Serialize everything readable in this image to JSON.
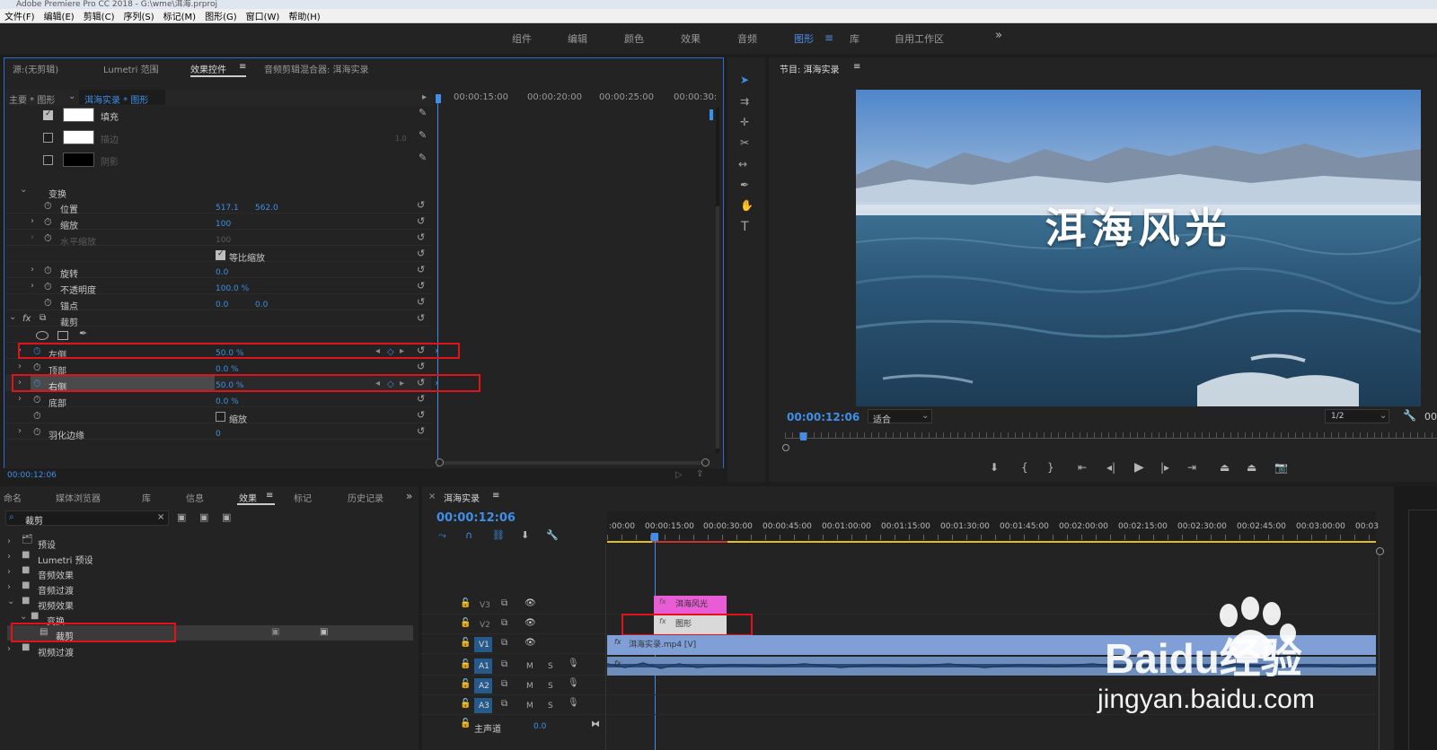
{
  "window_title": "Adobe Premiere Pro CC 2018 - G:\\wme\\洱海.prproj",
  "menu": [
    "文件(F)",
    "编辑(E)",
    "剪辑(C)",
    "序列(S)",
    "标记(M)",
    "图形(G)",
    "窗口(W)",
    "帮助(H)"
  ],
  "workspaces": [
    "组件",
    "编辑",
    "颜色",
    "效果",
    "音频",
    "图形",
    "库",
    "自用工作区"
  ],
  "workspace_active": "图形",
  "workspace_overflow": "»",
  "source_tabs": [
    "源:(无剪辑)",
    "Lumetri 范围",
    "效果控件",
    "音频剪辑混合器: 洱海实录"
  ],
  "effect_controls": {
    "header_master": "主要 * 图形",
    "header_clip": "洱海实录 * 图形",
    "ruler": [
      "00:00:15:00",
      "00:00:20:00",
      "00:00:25:00",
      "00:00:30:"
    ],
    "fill_label": "填充",
    "stroke_label": "描边",
    "stroke_value": "1.0",
    "shadow_label": "阴影",
    "transform_label": "变换",
    "position_label": "位置",
    "position_x": "517.1",
    "position_y": "562.0",
    "scale_label": "缩放",
    "scale_value": "100",
    "hscale_label": "水平缩放",
    "hscale_value": "100",
    "uniform_label": "等比缩放",
    "rotation_label": "旋转",
    "rotation_value": "0.0",
    "opacity_label": "不透明度",
    "opacity_value": "100.0 %",
    "anchor_label": "锚点",
    "anchor_x": "0.0",
    "anchor_y": "0.0",
    "fx_label": "fx",
    "crop_label": "裁剪",
    "left_label": "左侧",
    "left_value": "50.0 %",
    "top_label": "顶部",
    "top_value": "0.0 %",
    "right_label": "右侧",
    "right_value": "50.0 %",
    "bottom_label": "底部",
    "bottom_value": "0.0 %",
    "zoom_label": "缩放",
    "feather_label": "羽化边缘",
    "feather_value": "0",
    "timecode": "00:00:12:06"
  },
  "program": {
    "title": "节目: 洱海实录",
    "overlay_text": "洱海风光",
    "timecode": "00:00:12:06",
    "fit": "适合",
    "resolution": "1/2",
    "duration_partial": "00"
  },
  "project_tabs": [
    "命名",
    "媒体浏览器",
    "库",
    "信息",
    "效果",
    "标记",
    "历史记录"
  ],
  "effects_panel": {
    "search_value": "裁剪",
    "tree": [
      {
        "label": "预设"
      },
      {
        "label": "Lumetri 预设"
      },
      {
        "label": "音频效果"
      },
      {
        "label": "音频过渡"
      },
      {
        "label": "视频效果"
      },
      {
        "label": "变换"
      },
      {
        "label": "裁剪"
      },
      {
        "label": "视频过渡"
      }
    ]
  },
  "timeline": {
    "title": "洱海实录",
    "timecode": "00:00:12:06",
    "ruler": [
      ":00:00",
      "00:00:15:00",
      "00:00:30:00",
      "00:00:45:00",
      "00:01:00:00",
      "00:01:15:00",
      "00:01:30:00",
      "00:01:45:00",
      "00:02:00:00",
      "00:02:15:00",
      "00:02:30:00",
      "00:02:45:00",
      "00:03:00:00",
      "00:03"
    ],
    "tracks": [
      "V3",
      "V2",
      "V1",
      "A1",
      "A2",
      "A3"
    ],
    "track_buttons": {
      "mute": "M",
      "solo": "S"
    },
    "master_label": "主声道",
    "master_value": "0.0",
    "clip_v3": "洱海风光",
    "clip_v2": "图形",
    "clip_v1": "洱海实录.mp4 [V]"
  },
  "watermark": {
    "brand": "Baidu经验",
    "url": "jingyan.baidu.com"
  }
}
